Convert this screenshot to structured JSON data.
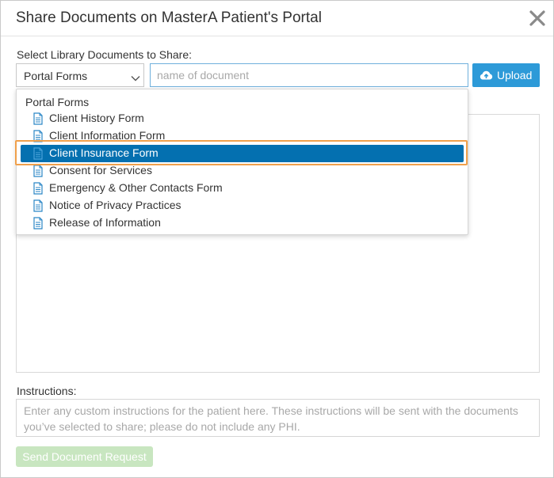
{
  "dialog": {
    "title": "Share Documents on MasterA Patient's Portal",
    "close_icon": "close-icon"
  },
  "library": {
    "label": "Select Library Documents to Share:",
    "selected": "Portal Forms",
    "search_placeholder": "name of document",
    "search_value": "",
    "upload_label": "Upload",
    "upload_icon": "cloud-upload-icon"
  },
  "dropdown": {
    "group_label": "Portal Forms",
    "item_icon": "document-icon",
    "items": [
      {
        "label": "Client History Form",
        "selected": false
      },
      {
        "label": "Client Information Form",
        "selected": false
      },
      {
        "label": "Client Insurance Form",
        "selected": true
      },
      {
        "label": "Consent for Services",
        "selected": false
      },
      {
        "label": "Emergency & Other Contacts Form",
        "selected": false
      },
      {
        "label": "Notice of Privacy Practices",
        "selected": false
      },
      {
        "label": "Release of Information",
        "selected": false
      }
    ]
  },
  "instructions": {
    "label": "Instructions:",
    "placeholder": "Enter any custom instructions for the patient here. These instructions will be sent with the documents you’ve selected to share; please do not include any PHI.",
    "value": ""
  },
  "actions": {
    "send_label": "Send Document Request",
    "send_enabled": false
  },
  "colors": {
    "accent": "#2d9ad8",
    "selected_row": "#0470b0",
    "highlight_outline": "#f0a04b",
    "doc_icon": "#2a86c6",
    "send_disabled": "#c8e6c0"
  }
}
